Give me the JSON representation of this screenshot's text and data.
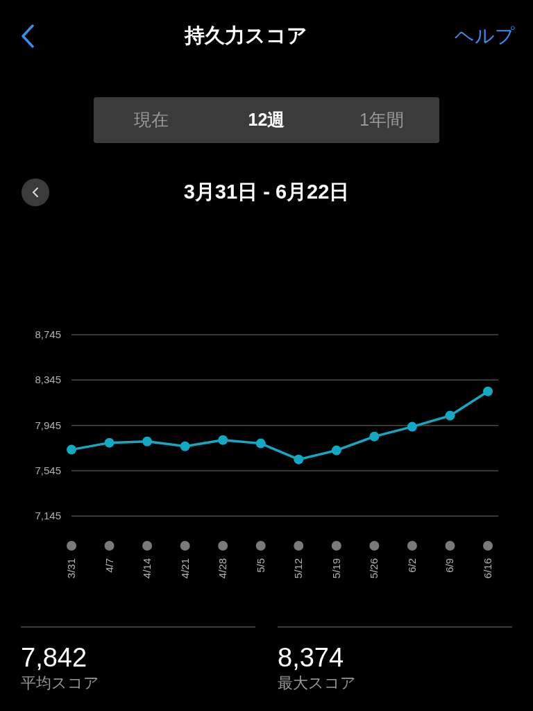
{
  "header": {
    "title": "持久力スコア",
    "help": "ヘルプ"
  },
  "tabs": [
    {
      "label": "現在",
      "selected": false
    },
    {
      "label": "12週",
      "selected": true
    },
    {
      "label": "1年間",
      "selected": false
    }
  ],
  "date_range": "3月31日 - 6月22日",
  "chart_data": {
    "type": "line",
    "categories": [
      "3/31",
      "4/7",
      "4/14",
      "4/21",
      "4/28",
      "5/5",
      "5/12",
      "5/19",
      "5/26",
      "6/2",
      "6/9",
      "6/16"
    ],
    "grid": true,
    "series": [
      {
        "color": "#12a9c4",
        "marker": true,
        "values": [
          7731,
          7792,
          7804,
          7761,
          7816,
          7786,
          7645,
          7725,
          7847,
          7933,
          8031,
          8245
        ]
      }
    ],
    "ylim": [
      7145,
      8745
    ],
    "yticks": [
      {
        "value": 8745,
        "label": "8,745"
      },
      {
        "value": 8345,
        "label": "8,345"
      },
      {
        "value": 7945,
        "label": "7,945"
      },
      {
        "value": 7545,
        "label": "7,545"
      },
      {
        "value": 7145,
        "label": "7,145"
      }
    ]
  },
  "stats": [
    {
      "value": "7,842",
      "label": "平均スコア"
    },
    {
      "value": "8,374",
      "label": "最大スコア"
    }
  ]
}
